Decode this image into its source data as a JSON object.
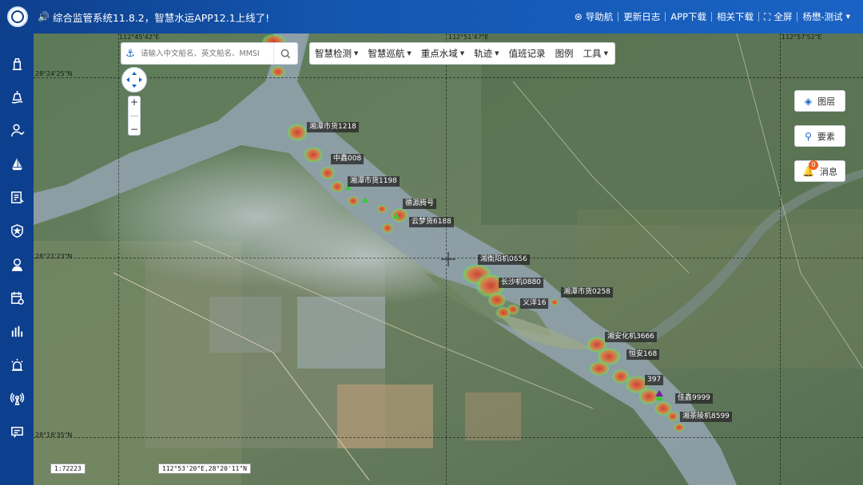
{
  "header": {
    "notice": "综合监管系统11.8.2，智慧水运APP12.1上线了!",
    "nav": {
      "guide": "导助航",
      "changelog": "更新日志",
      "app_download": "APP下载",
      "related_download": "相关下载",
      "fullscreen": "全屏",
      "user": "杨懋-测试"
    }
  },
  "search": {
    "placeholder": "请输入中文船名、英文船名、MMSI"
  },
  "menu": {
    "items": [
      {
        "label": "智慧检测",
        "dropdown": true
      },
      {
        "label": "智慧巡航",
        "dropdown": true
      },
      {
        "label": "重点水域",
        "dropdown": true
      },
      {
        "label": "轨迹",
        "dropdown": true
      },
      {
        "label": "值班记录",
        "dropdown": false
      },
      {
        "label": "图例",
        "dropdown": false
      },
      {
        "label": "工具",
        "dropdown": true
      }
    ]
  },
  "right_panel": {
    "layers": "图层",
    "elements": "要素",
    "messages": "消息",
    "message_count": "0"
  },
  "vessels": {
    "v1": "湘潭市货1218",
    "v2": "中鑫008",
    "v3": "湘潭市货1198",
    "v4": "德源腾号",
    "v5": "云梦货6188",
    "v6": "湘衡阳机0656",
    "v7": "长沙机0880",
    "v8": "义洋16",
    "v9": "湘潭市货0258",
    "v10": "湘安化机3666",
    "v11": "恒安168",
    "v12": "佳鑫9999",
    "v13": "湘茶陵机8599",
    "v14": "397"
  },
  "coords": {
    "top_lon1": "112°45'42\"E",
    "top_lon2": "112°51'47\"E",
    "top_lon3": "112°57'52\"E",
    "left_lat1": "28°24'25\"N",
    "left_lat2": "28°21'23\"N",
    "left_lat3": "28°18'35\"N"
  },
  "status": {
    "scale": "1:72223",
    "cursor": "112°53'20\"E,28°20'11\"N"
  },
  "colors": {
    "header_bg": "#1456b0",
    "sidebar_bg": "#0d3f8f",
    "accent": "#1a63c4",
    "badge": "#f06020"
  }
}
